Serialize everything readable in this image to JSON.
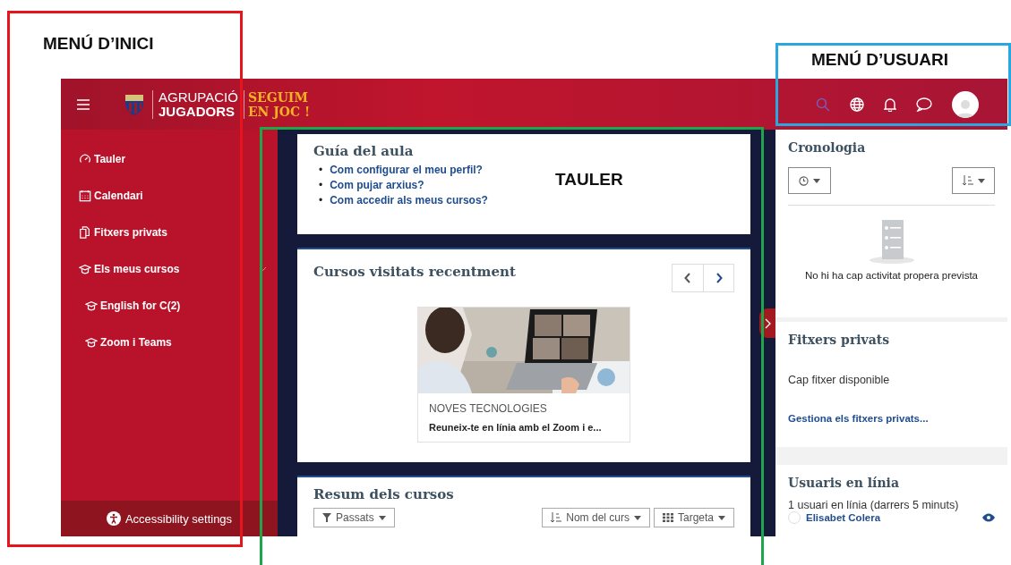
{
  "annotations": [
    {
      "label": "MENÚ D’INICI",
      "color": "#e8141b"
    },
    {
      "label": "MENÚ D’USUARI",
      "color": "#29a8e0"
    },
    {
      "label": "TAULER",
      "color": "#1fa64a"
    }
  ],
  "header": {
    "brand_top": "AGRUPACIÓ",
    "brand_bottom": "JUGADORS",
    "slogan_top": "SEGUIM",
    "slogan_bottom": "EN JOC !"
  },
  "sidebar": {
    "items": [
      {
        "label": "Tauler"
      },
      {
        "label": "Calendari"
      },
      {
        "label": "Fitxers privats"
      },
      {
        "label": "Els meus cursos",
        "children": [
          {
            "label": "English for C(2)"
          },
          {
            "label": "Zoom i Teams"
          }
        ]
      }
    ],
    "footer": "Accessibility settings"
  },
  "guide": {
    "title": "Guía del aula",
    "bullet": "•",
    "links": [
      "Com configurar el meu perfil?",
      "Com pujar arxius?",
      "Com accedir als meus cursos?"
    ]
  },
  "recent": {
    "title": "Cursos visitats recentment",
    "course": {
      "kind": "picture",
      "category": "NOVES TECNOLOGIES",
      "name": "Reuneix-te en línia amb el Zoom i e..."
    }
  },
  "overview": {
    "title": "Resum dels cursos",
    "filter": "Passats",
    "sort": "Nom del curs",
    "view": "Targeta"
  },
  "timeline": {
    "title": "Cronologia",
    "empty": "No hi ha cap activitat propera prevista"
  },
  "private_files": {
    "title": "Fitxers privats",
    "empty": "Cap fitxer disponible",
    "link": "Gestiona els fitxers privats..."
  },
  "online": {
    "title": "Usuaris en línia",
    "summary": "1 usuari en línia (darrers 5 minuts)",
    "users": [
      "Elisabet Colera"
    ]
  }
}
